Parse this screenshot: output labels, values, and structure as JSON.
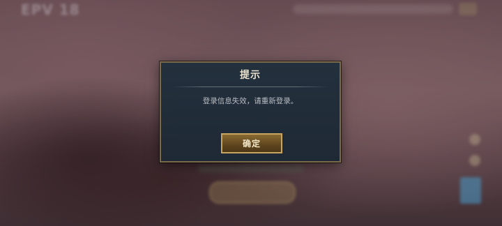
{
  "background": {
    "logo_text": "EPV 18"
  },
  "dialog": {
    "title": "提示",
    "message": "登录信息失效，请重新登录。",
    "confirm_label": "确定"
  },
  "colors": {
    "dialog_bg": "#1f2935",
    "dialog_border": "#7a6a4a",
    "button_border": "#c9a660",
    "button_bg": "#5e451e"
  }
}
